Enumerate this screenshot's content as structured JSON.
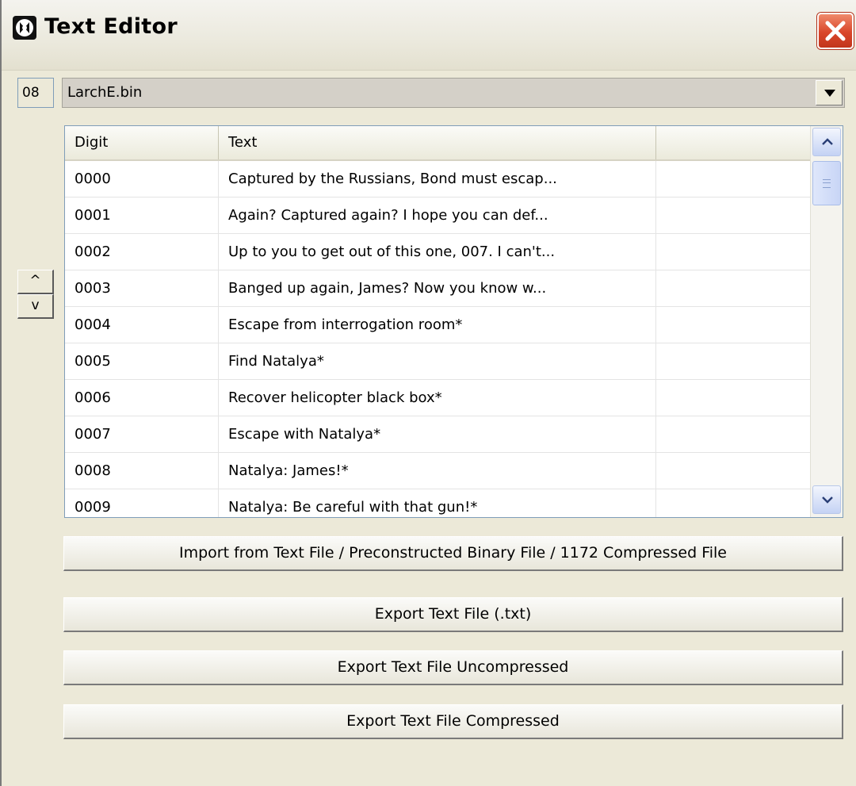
{
  "window": {
    "title": "Text Editor"
  },
  "file_selector": {
    "index": "08",
    "selected_file": "LarchE.bin"
  },
  "updown": {
    "up_label": "^",
    "down_label": "v"
  },
  "table": {
    "columns": [
      "Digit",
      "Text",
      ""
    ],
    "rows": [
      {
        "digit": "0000",
        "text": "Captured by the Russians, Bond must escap..."
      },
      {
        "digit": "0001",
        "text": "Again? Captured again? I hope you can def..."
      },
      {
        "digit": "0002",
        "text": "Up to you to get out of this one, 007. I can't..."
      },
      {
        "digit": "0003",
        "text": "Banged up again, James? Now you know w..."
      },
      {
        "digit": "0004",
        "text": "Escape from interrogation room*"
      },
      {
        "digit": "0005",
        "text": "Find Natalya*"
      },
      {
        "digit": "0006",
        "text": "Recover helicopter black box*"
      },
      {
        "digit": "0007",
        "text": "Escape with Natalya*"
      },
      {
        "digit": "0008",
        "text": "Natalya: James!*"
      },
      {
        "digit": "0009",
        "text": "Natalya: Be careful with that gun!*"
      }
    ]
  },
  "buttons": {
    "import": "Import from Text File / Preconstructed Binary File / 1172 Compressed File",
    "export_txt": "Export Text File (.txt)",
    "export_uncompressed": "Export Text File Uncompressed",
    "export_compressed": "Export Text File Compressed"
  },
  "colors": {
    "window_bg": "#ece9d8",
    "close_red": "#d9462a",
    "scroll_blue": "#c4d2f4"
  }
}
